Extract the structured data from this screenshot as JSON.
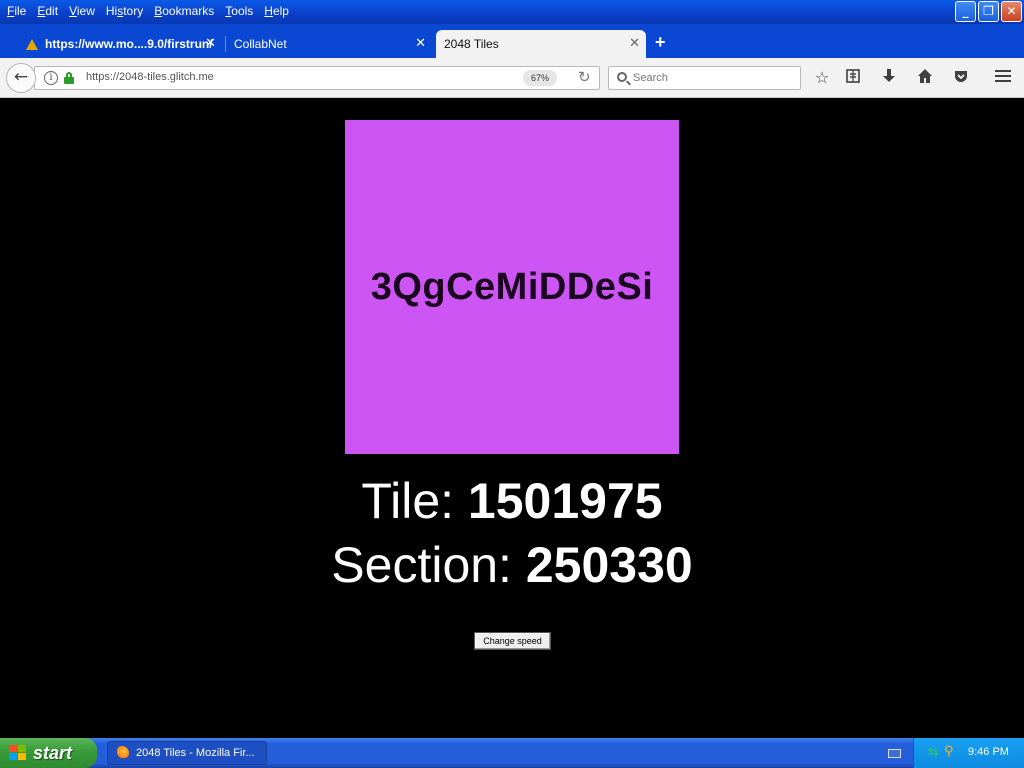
{
  "menubar": {
    "items": [
      {
        "prefix": "",
        "underline": "F",
        "rest": "ile"
      },
      {
        "prefix": "",
        "underline": "E",
        "rest": "dit"
      },
      {
        "prefix": "",
        "underline": "V",
        "rest": "iew"
      },
      {
        "prefix": "Hi",
        "underline": "s",
        "rest": "tory"
      },
      {
        "prefix": "",
        "underline": "B",
        "rest": "ookmarks"
      },
      {
        "prefix": "",
        "underline": "T",
        "rest": "ools"
      },
      {
        "prefix": "",
        "underline": "H",
        "rest": "elp"
      }
    ]
  },
  "window_controls": {
    "minimize": "_",
    "restore": "❐",
    "close": "✕"
  },
  "tabs": [
    {
      "label": "https://www.mo....9.0/firstrun/",
      "close": "✕",
      "warning": true
    },
    {
      "label": "CollabNet",
      "close": "✕",
      "warning": false
    },
    {
      "label": "2048 Tiles",
      "close": "✕",
      "warning": false
    }
  ],
  "new_tab": "+",
  "navbar": {
    "back": "←",
    "info": "i",
    "url": "https://2048-tiles.glitch.me",
    "zoom": "67%",
    "reload": "↻",
    "search_placeholder": "Search",
    "icons": [
      "star-icon",
      "reading-list-icon",
      "download-icon",
      "home-icon",
      "pocket-icon",
      "menu-icon"
    ]
  },
  "content": {
    "tile_text": "3QgCeMiDDeSi",
    "tile_color": "#cc55f4",
    "tile_label": "Tile: ",
    "tile_value": "1501975",
    "section_label": "Section: ",
    "section_value": "250330",
    "button_label": "Change speed"
  },
  "taskbar": {
    "start_label": "start",
    "task_label": "2048 Tiles - Mozilla Fir...",
    "clock": "9:46 PM"
  }
}
